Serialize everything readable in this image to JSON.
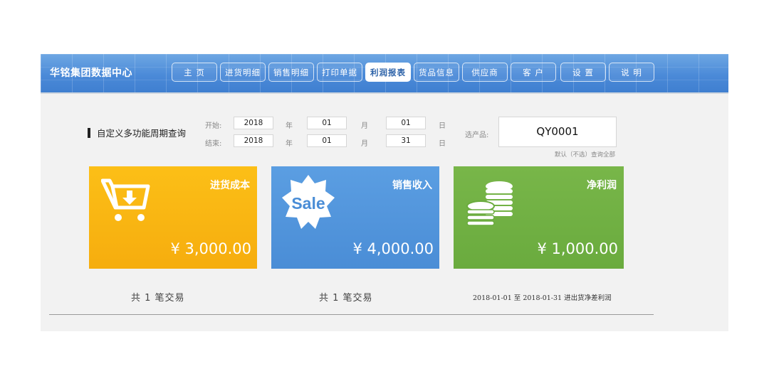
{
  "header": {
    "brand": "华铭集团数据中心",
    "nav": [
      {
        "label": "主  页"
      },
      {
        "label": "进货明细"
      },
      {
        "label": "销售明细"
      },
      {
        "label": "打印单据"
      },
      {
        "label": "利润报表",
        "active": true
      },
      {
        "label": "货品信息"
      },
      {
        "label": "供应商"
      },
      {
        "label": "客  户"
      },
      {
        "label": "设  置"
      },
      {
        "label": "说  明"
      }
    ]
  },
  "query": {
    "title": "自定义多功能周期查询",
    "start_label": "开始:",
    "end_label": "结束:",
    "year_unit": "年",
    "month_unit": "月",
    "day_unit": "日",
    "start": {
      "year": "2018",
      "month": "01",
      "day": "01"
    },
    "end": {
      "year": "2018",
      "month": "01",
      "day": "31"
    },
    "product_label": "选产品:",
    "product_value": "QY0001",
    "product_hint": "默认（不选）查询全部"
  },
  "cards": {
    "cost": {
      "title": "进货成本",
      "amount": "¥ 3,000.00",
      "color": "#f9b912"
    },
    "sale": {
      "title": "销售收入",
      "amount": "¥ 4,000.00",
      "icon_text": "Sale",
      "color": "#4f93db"
    },
    "profit": {
      "title": "净利润",
      "amount": "¥ 1,000.00",
      "color": "#71b043"
    }
  },
  "footer": {
    "cost_count": "共 1 笔交易",
    "sale_count": "共 1 笔交易",
    "range_note": "2018-01-01 至 2018-01-31 进出货净差利润"
  },
  "icons": {
    "cost": "cart-download-icon",
    "sale": "sale-badge-icon",
    "profit": "coins-icon"
  }
}
